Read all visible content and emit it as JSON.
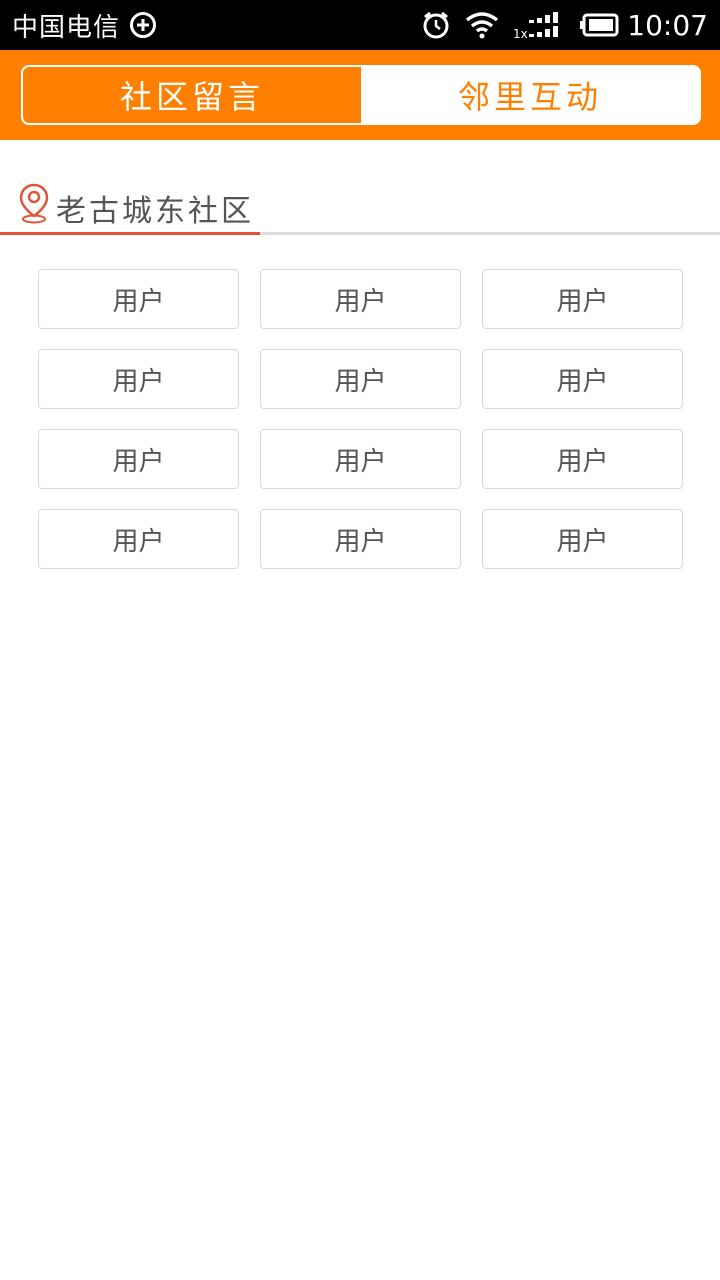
{
  "status_bar": {
    "carrier": "中国电信",
    "time": "10:07",
    "network_label": "1x",
    "icons": [
      "plus-circle-icon",
      "alarm-icon",
      "wifi-icon",
      "signal-icon",
      "battery-icon"
    ]
  },
  "tabs": [
    {
      "label": "社区留言",
      "active": true
    },
    {
      "label": "邻里互动",
      "active": false
    }
  ],
  "location": {
    "icon": "location-pin-icon",
    "name": "老古城东社区"
  },
  "users": [
    "用户",
    "用户",
    "用户",
    "用户",
    "用户",
    "用户",
    "用户",
    "用户",
    "用户",
    "用户",
    "用户",
    "用户"
  ],
  "colors": {
    "accent": "#ff7f00",
    "location_accent": "#e0553a",
    "text_gray": "#555555",
    "border_gray": "#d8d8d8"
  }
}
